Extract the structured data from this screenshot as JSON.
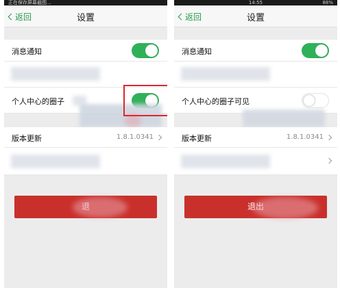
{
  "left": {
    "statusbar": {
      "left_text": "正在保存屏幕截图...",
      "time": "",
      "right_text": ""
    },
    "nav": {
      "back_label": "返回",
      "title": "设置"
    },
    "rows": {
      "notify": {
        "label": "消息通知",
        "toggle": "on"
      },
      "circle": {
        "label": "个人中心的圈子",
        "toggle": "on"
      },
      "version": {
        "label": "版本更新",
        "value": "1.8.1.0341"
      }
    },
    "logout_label": "退"
  },
  "right": {
    "statusbar": {
      "left_text": "",
      "time": "14:55",
      "right_text": "88%"
    },
    "nav": {
      "back_label": "返回",
      "title": "设置"
    },
    "rows": {
      "notify": {
        "label": "消息通知",
        "toggle": "on"
      },
      "circle": {
        "label": "个人中心的圈子可见",
        "toggle": "off"
      },
      "version": {
        "label": "版本更新",
        "value": "1.8.1.0341"
      }
    },
    "logout_label": "退出"
  },
  "colors": {
    "accent_green": "#2fb158",
    "logout_red": "#c9302b",
    "highlight_red": "#d8282e"
  }
}
